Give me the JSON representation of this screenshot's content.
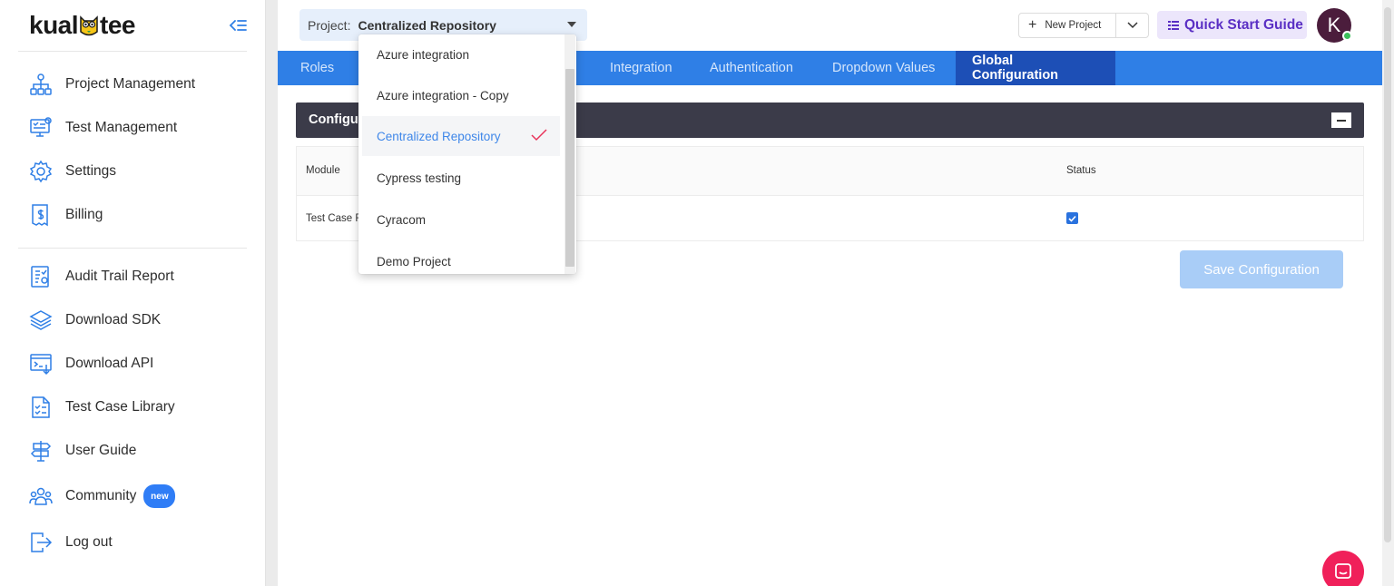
{
  "logo": {
    "text_a": "kual",
    "text_b": "tee"
  },
  "sidebar": {
    "items": [
      {
        "label": "Project Management",
        "icon": "hierarchy-icon"
      },
      {
        "label": "Test Management",
        "icon": "test-monitor-icon"
      },
      {
        "label": "Settings",
        "icon": "gear-icon"
      },
      {
        "label": "Billing",
        "icon": "receipt-icon"
      },
      {
        "label": "Audit Trail Report",
        "icon": "report-icon"
      },
      {
        "label": "Download SDK",
        "icon": "layers-icon"
      },
      {
        "label": "Download API",
        "icon": "api-window-icon"
      },
      {
        "label": "Test Case Library",
        "icon": "checklist-doc-icon"
      },
      {
        "label": "User Guide",
        "icon": "signpost-icon"
      },
      {
        "label": "Community",
        "icon": "people-icon",
        "badge": "new"
      },
      {
        "label": "Log out",
        "icon": "logout-icon"
      }
    ]
  },
  "header": {
    "project_label": "Project:",
    "project_value": "Centralized Repository",
    "new_project_label": "New Project",
    "quick_start_label": "Quick Start Guide",
    "avatar_initial": "K"
  },
  "tabs": [
    {
      "label": "Roles",
      "active": false
    },
    {
      "label": "Integration",
      "active": false
    },
    {
      "label": "Authentication",
      "active": false
    },
    {
      "label": "Dropdown Values",
      "active": false
    },
    {
      "label": "Global Configuration",
      "active": true
    }
  ],
  "panel": {
    "title": "Configu",
    "columns": [
      "Module",
      "Status"
    ],
    "rows": [
      {
        "module": "Test Case F",
        "status_checked": true
      }
    ]
  },
  "save_button_label": "Save Configuration",
  "dropdown": {
    "options": [
      "Azure integration",
      "Azure integration - Copy",
      "Centralized Repository",
      "Cypress testing",
      "Cyracom",
      "Demo Project"
    ],
    "selected": "Centralized Repository"
  },
  "colors": {
    "accent_blue": "#2f7fe6",
    "active_tab": "#1d4fb6",
    "panel_header": "#3b3b49",
    "quick_start_text": "#5a2fc4",
    "chat_bubble": "#f0205a"
  }
}
